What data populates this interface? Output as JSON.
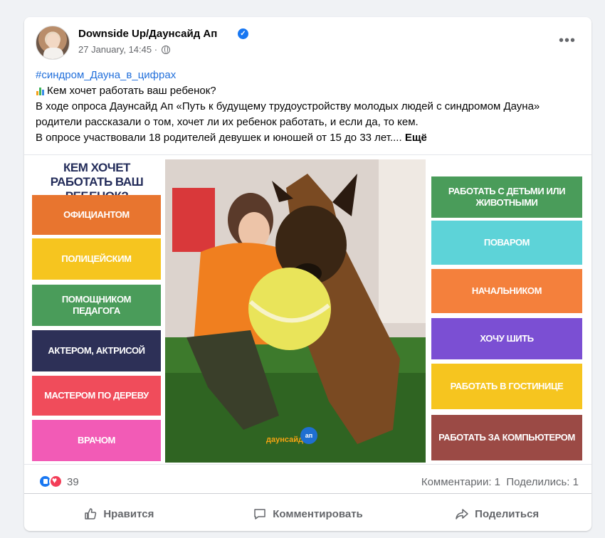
{
  "post": {
    "page_name": "Downside Up/Даунсайд Ап",
    "date": "27 January, 14:45",
    "date_separator": " · ",
    "more_label": "•••",
    "hashtag": "#синдром_Дауна_в_цифрах",
    "line1": "Кем хочет работать ваш ребенок?",
    "body": "В ходе опроса Даунсайд Ап «Путь к будущему трудоустройству молодых людей с синдромом Дауна» родители рассказали о том, хочет ли их ребенок работать, и если да, то кем.",
    "last_line": "В опросе участвовали 18 родителей девушек и юношей от 15 до 33 лет....",
    "see_more": "Ещё"
  },
  "image": {
    "title": "КЕМ ХОЧЕТ РАБОТАТЬ ВАШ РЕБЕНОК?",
    "logo_text": "даунсайд",
    "logo_ball_text": "ап",
    "left_tiles": [
      {
        "label": "ОФИЦИАНТОМ",
        "color": "#e8752f"
      },
      {
        "label": "ПОЛИЦЕЙСКИМ",
        "color": "#f6c51f"
      },
      {
        "label": "ПОМОЩНИКОМ ПЕДАГОГА",
        "color": "#4a9c5a"
      },
      {
        "label": "АКТЕРОМ, АКТРИСОЙ",
        "color": "#2d3057"
      },
      {
        "label": "МАСТЕРОМ ПО ДЕРЕВУ",
        "color": "#f04c5b"
      },
      {
        "label": "ВРАЧОМ",
        "color": "#f25bb6"
      }
    ],
    "right_tiles": [
      {
        "label": "РАБОТАТЬ С ДЕТЬМИ ИЛИ ЖИВОТНЫМИ",
        "color": "#4a9c5a"
      },
      {
        "label": "ПОВАРОМ",
        "color": "#5dd3d8"
      },
      {
        "label": "НАЧАЛЬНИКОМ",
        "color": "#f4803c"
      },
      {
        "label": "ХОЧУ ШИТЬ",
        "color": "#7b4fd3"
      },
      {
        "label": "РАБОТАТЬ В ГОСТИНИЦЕ",
        "color": "#f6c51f"
      },
      {
        "label": "РАБОТАТЬ ЗА КОМПЬЮТЕРОМ",
        "color": "#9b4a45"
      }
    ]
  },
  "stats": {
    "reactions_count": "39",
    "comments": "Комментарии: 1",
    "shares": "Поделились: 1"
  },
  "actions": {
    "like": "Нравится",
    "comment": "Комментировать",
    "share": "Поделиться"
  },
  "colors": {
    "accent": "#1877f2",
    "hashtag": "#216fdb",
    "love": "#f33e58"
  }
}
